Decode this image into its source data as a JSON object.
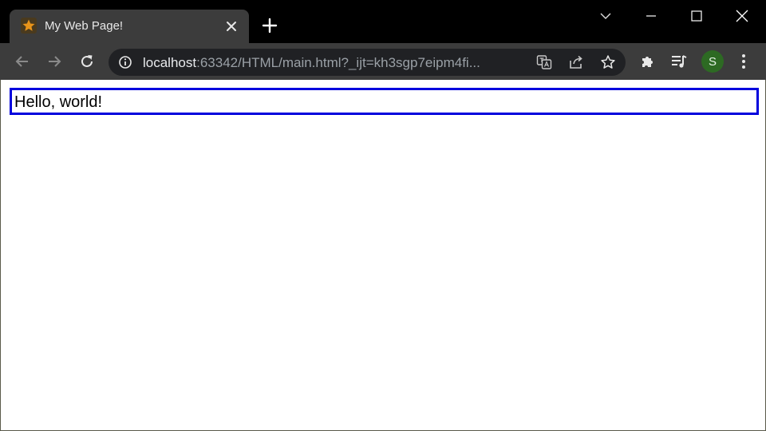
{
  "browser": {
    "tab": {
      "title": "My Web Page!",
      "favicon": "star-icon",
      "favicon_color": "#e8941a"
    },
    "address_bar": {
      "host": "localhost",
      "rest": ":63342/HTML/main.html?_ijt=kh3sgp7eipm4fi..."
    },
    "profile": {
      "initial": "S",
      "color": "#2d6a23"
    }
  },
  "page": {
    "content_text": "Hello, world!",
    "border_color": "#0000dd"
  }
}
